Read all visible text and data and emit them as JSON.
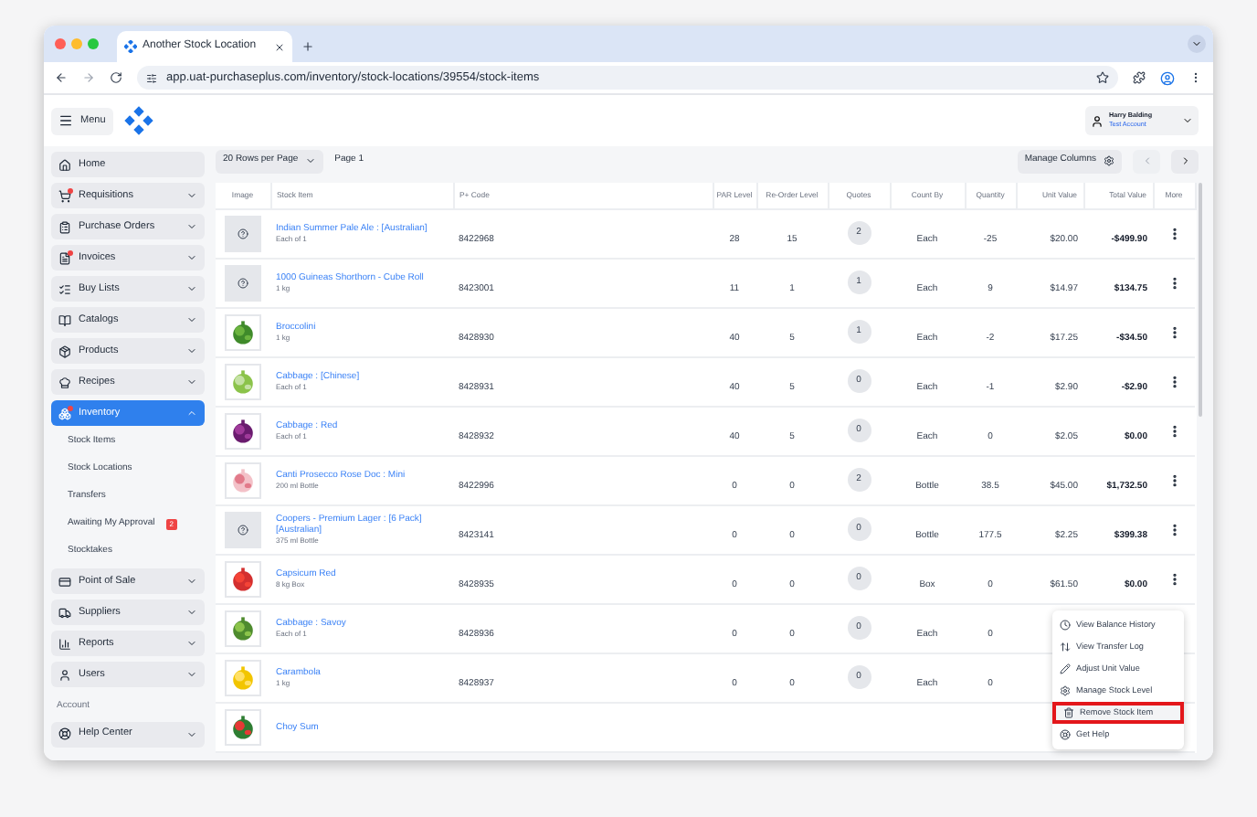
{
  "browser": {
    "tab_title": "Another Stock Location",
    "url": "app.uat-purchaseplus.com/inventory/stock-locations/39554/stock-items"
  },
  "header": {
    "menu_label": "Menu",
    "user_name": "Harry Balding",
    "account": "Test Account"
  },
  "sidebar": {
    "items": [
      {
        "kind": "item",
        "label": "Home",
        "alert": false,
        "selected": false
      },
      {
        "kind": "item",
        "label": "Requisitions",
        "alert": true,
        "selected": false,
        "expanded": false
      },
      {
        "kind": "item",
        "label": "Purchase Orders",
        "alert": false,
        "selected": false,
        "expanded": false
      },
      {
        "kind": "item",
        "label": "Invoices",
        "alert": true,
        "selected": false,
        "expanded": false
      },
      {
        "kind": "item",
        "label": "Buy Lists",
        "alert": false,
        "selected": false,
        "expanded": false
      },
      {
        "kind": "item",
        "label": "Catalogs",
        "alert": false,
        "selected": false,
        "expanded": false
      },
      {
        "kind": "item",
        "label": "Products",
        "alert": false,
        "selected": false,
        "expanded": false
      },
      {
        "kind": "item",
        "label": "Recipes",
        "alert": false,
        "selected": false,
        "expanded": false
      },
      {
        "kind": "item",
        "label": "Inventory",
        "alert": true,
        "selected": true,
        "expanded": true,
        "children": [
          {
            "label": "Stock Items"
          },
          {
            "label": "Stock Locations"
          },
          {
            "label": "Transfers"
          },
          {
            "label": "Awaiting My Approval",
            "badge": "2"
          },
          {
            "label": "Stocktakes"
          }
        ]
      },
      {
        "kind": "item",
        "label": "Point of Sale",
        "alert": false,
        "selected": false,
        "expanded": false
      },
      {
        "kind": "item",
        "label": "Suppliers",
        "alert": false,
        "selected": false,
        "expanded": false
      },
      {
        "kind": "item",
        "label": "Reports",
        "alert": false,
        "selected": false,
        "expanded": false
      },
      {
        "kind": "item",
        "label": "Users",
        "alert": false,
        "selected": false,
        "expanded": false
      },
      {
        "kind": "heading",
        "label": "Account"
      },
      {
        "kind": "item",
        "label": "Help Center",
        "alert": false,
        "selected": false,
        "expanded": false
      }
    ]
  },
  "toolbar": {
    "rows_per_page": "20 Rows per Page",
    "page": "Page 1",
    "manage_columns": "Manage Columns"
  },
  "table": {
    "columns": [
      "Image",
      "Stock Item",
      "P+ Code",
      "PAR Level",
      "Re-Order Level",
      "Quotes",
      "Count By",
      "Quantity",
      "Unit Value",
      "Total Value",
      "More"
    ],
    "rows": [
      {
        "image": {
          "kind": "missing"
        },
        "name": "Indian Summer Pale Ale : [Australian]",
        "unit": "Each of 1",
        "code": "8422968",
        "par": "28",
        "reorder": "15",
        "quotes": "2",
        "count_by": "Each",
        "quantity": "-25",
        "unit_value": "$20.00",
        "total_value": "-$499.90"
      },
      {
        "image": {
          "kind": "missing"
        },
        "name": "1000 Guineas Shorthorn - Cube Roll",
        "unit": "1 kg",
        "code": "8423001",
        "par": "11",
        "reorder": "1",
        "quotes": "1",
        "count_by": "Each",
        "quantity": "9",
        "unit_value": "$14.97",
        "total_value": "$134.75"
      },
      {
        "name": "Broccolini",
        "unit": "1 kg",
        "code": "8428930",
        "par": "40",
        "reorder": "5",
        "quotes": "1",
        "count_by": "Each",
        "quantity": "-2",
        "unit_value": "$17.25",
        "total_value": "-$34.50"
      },
      {
        "name": "Cabbage : [Chinese]",
        "unit": "Each of 1",
        "code": "8428931",
        "par": "40",
        "reorder": "5",
        "quotes": "0",
        "count_by": "Each",
        "quantity": "-1",
        "unit_value": "$2.90",
        "total_value": "-$2.90"
      },
      {
        "name": "Cabbage : Red",
        "unit": "Each of 1",
        "code": "8428932",
        "par": "40",
        "reorder": "5",
        "quotes": "0",
        "count_by": "Each",
        "quantity": "0",
        "unit_value": "$2.05",
        "total_value": "$0.00"
      },
      {
        "name": "Canti Prosecco Rose Doc : Mini",
        "unit": "200 ml Bottle",
        "code": "8422996",
        "par": "0",
        "reorder": "0",
        "quotes": "2",
        "count_by": "Bottle",
        "quantity": "38.5",
        "unit_value": "$45.00",
        "total_value": "$1,732.50"
      },
      {
        "image": {
          "kind": "missing"
        },
        "name": "Coopers - Premium Lager : [6 Pack] [Australian]",
        "unit": "375 ml Bottle",
        "code": "8423141",
        "par": "0",
        "reorder": "0",
        "quotes": "0",
        "count_by": "Bottle",
        "quantity": "177.5",
        "unit_value": "$2.25",
        "total_value": "$399.38"
      },
      {
        "name": "Capsicum Red",
        "unit": "8 kg Box",
        "code": "8428935",
        "par": "0",
        "reorder": "0",
        "quotes": "0",
        "count_by": "Box",
        "quantity": "0",
        "unit_value": "$61.50",
        "total_value": "$0.00"
      },
      {
        "name": "Cabbage : Savoy",
        "unit": "Each of 1",
        "code": "8428936",
        "par": "0",
        "reorder": "0",
        "quotes": "0",
        "count_by": "Each",
        "quantity": "0"
      },
      {
        "name": "Carambola",
        "unit": "1 kg",
        "code": "8428937",
        "par": "0",
        "reorder": "0",
        "quotes": "0",
        "count_by": "Each",
        "quantity": "0"
      },
      {
        "name": "Choy Sum"
      }
    ]
  },
  "context_menu": {
    "items": [
      {
        "label": "View Balance History",
        "highlighted": false
      },
      {
        "label": "View Transfer Log",
        "highlighted": false
      },
      {
        "label": "Adjust Unit Value",
        "highlighted": false
      },
      {
        "label": "Manage Stock Level",
        "highlighted": false
      },
      {
        "label": "Remove Stock Item",
        "highlighted": true
      },
      {
        "label": "Get Help",
        "highlighted": false
      }
    ]
  }
}
